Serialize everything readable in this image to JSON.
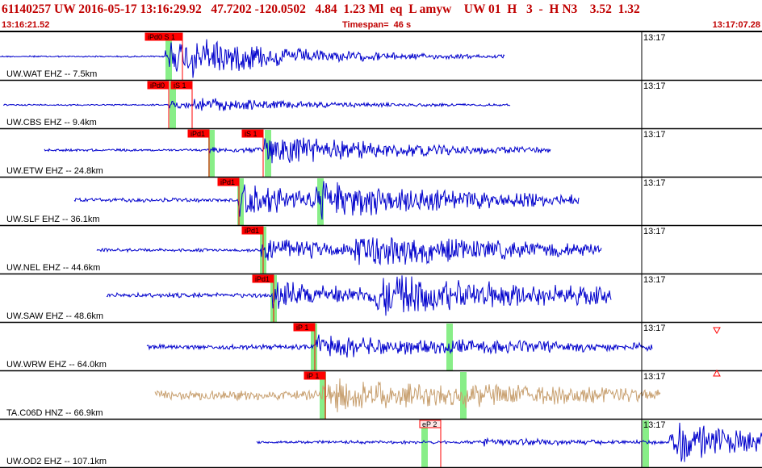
{
  "header": {
    "line1": "61140257 UW 2016-05-17 13:16:29.92   47.7202 -120.0502   4.84  1.23 Ml  eq  L amyw    UW 01  H   3  -  H N3    3.52  1.32",
    "start_time": "13:16:21.52",
    "timespan": "Timespan=  46 s",
    "end_time": "13:17:07.28"
  },
  "colors": {
    "trace": "#0000cc",
    "trace_alt": "#c8a070",
    "pick": "#ff0000",
    "window": "#88ee88",
    "header": "#c00000"
  },
  "minute_label": "13:17",
  "traces": [
    {
      "station": "UW.WAT EHZ -- 7.5km",
      "color": "trace",
      "picks": [
        "iPd0 S 1"
      ]
    },
    {
      "station": "UW.CBS EHZ -- 9.4km",
      "color": "trace",
      "picks": [
        "iPd0",
        "iS 1"
      ]
    },
    {
      "station": "UW.ETW EHZ -- 24.8km",
      "color": "trace",
      "picks": [
        "iPd1",
        "iS 1"
      ]
    },
    {
      "station": "UW.SLF EHZ -- 36.1km",
      "color": "trace",
      "picks": [
        "iPd1"
      ]
    },
    {
      "station": "UW.NEL EHZ -- 44.6km",
      "color": "trace",
      "picks": [
        "iPd1"
      ]
    },
    {
      "station": "UW.SAW EHZ -- 48.6km",
      "color": "trace",
      "picks": [
        "iPd1"
      ]
    },
    {
      "station": "UW.WRW EHZ -- 64.0km",
      "color": "trace",
      "picks": [
        "iP 1"
      ]
    },
    {
      "station": "TA.C06D HNZ -- 66.9km",
      "color": "trace_alt",
      "picks": [
        "iP 1"
      ]
    },
    {
      "station": "UW.OD2 EHZ -- 107.1km",
      "color": "trace",
      "picks": [
        "eP 2"
      ]
    }
  ]
}
